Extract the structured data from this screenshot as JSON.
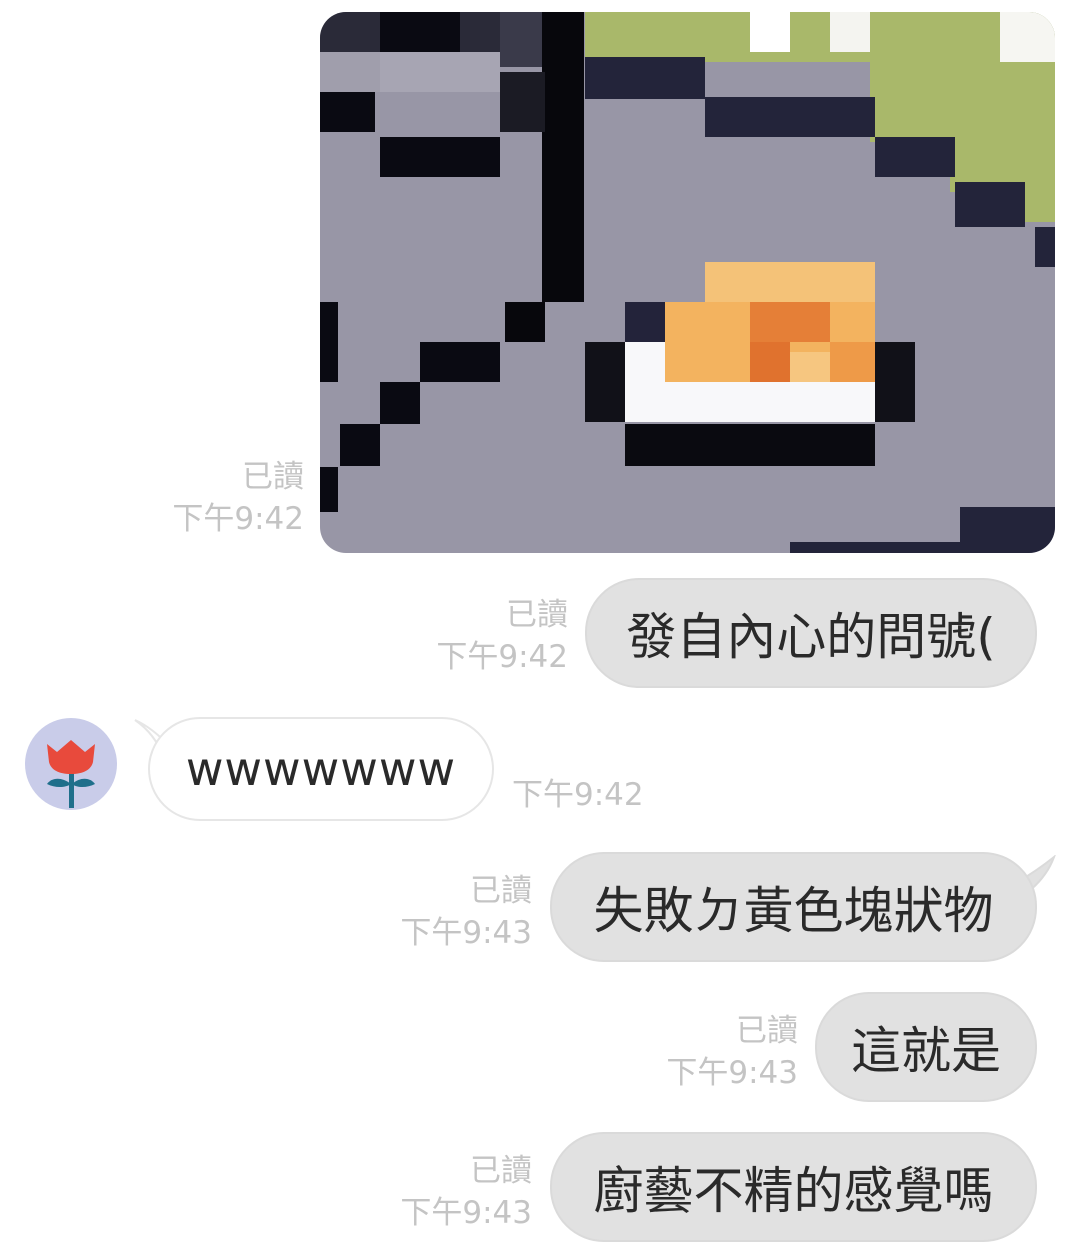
{
  "colors": {
    "outgoing_bubble": "#e1e1e1",
    "incoming_bubble": "#ffffff",
    "meta_text": "#c4c4c4",
    "avatar_bg": "#c9cce9",
    "flower_red": "#e84a3c",
    "flower_stem": "#1f6f8b"
  },
  "messages": [
    {
      "type": "image",
      "direction": "out",
      "read": "已讀",
      "time": "下午9:42"
    },
    {
      "type": "text",
      "direction": "out",
      "text": "發自內心的問號(",
      "read": "已讀",
      "time": "下午9:42"
    },
    {
      "type": "text",
      "direction": "in",
      "text": "wwwwwww",
      "time": "下午9:42",
      "avatar_icon": "tulip-icon"
    },
    {
      "type": "text",
      "direction": "out",
      "text": "失敗ㄉ黃色塊狀物",
      "read": "已讀",
      "time": "下午9:43"
    },
    {
      "type": "text",
      "direction": "out",
      "text": "這就是",
      "read": "已讀",
      "time": "下午9:43"
    },
    {
      "type": "text",
      "direction": "out",
      "text": "廚藝不精的感覺嗎",
      "read": "已讀",
      "time": "下午9:43"
    }
  ]
}
